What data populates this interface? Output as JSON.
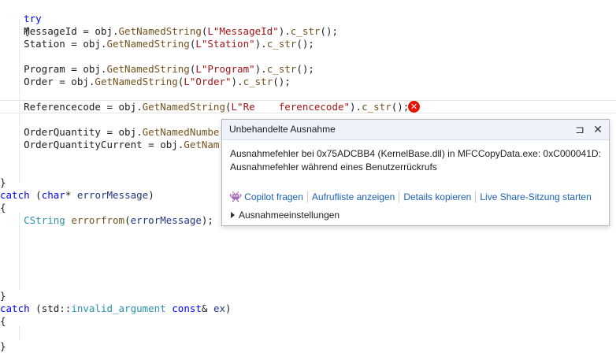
{
  "code": {
    "l_try": "try",
    "l_open1": "{",
    "msg_a": "    MessageId = obj.",
    "msg_fn": "GetNamedString",
    "msg_b": "(",
    "msg_str": "L\"MessageId\"",
    "msg_c": ").",
    "msg_fn2": "c_str",
    "msg_d": "();",
    "st_a": "    Station = obj.",
    "st_fn": "GetNamedString",
    "st_b": "(",
    "st_str": "L\"Station\"",
    "st_c": ").",
    "st_fn2": "c_str",
    "st_d": "();",
    "pr_a": "    Program = obj.",
    "pr_fn": "GetNamedString",
    "pr_b": "(",
    "pr_str": "L\"Program\"",
    "pr_c": ").",
    "pr_fn2": "c_str",
    "pr_d": "();",
    "or_a": "    Order = obj.",
    "or_fn": "GetNamedString",
    "or_b": "(",
    "or_str": "L\"Order\"",
    "or_c": ").",
    "or_fn2": "c_str",
    "or_d": "();",
    "rc_a": "    Referencecode = obj.",
    "rc_fn": "GetNamedString",
    "rc_b": "(",
    "rc_str": "L\"Re    ferencecode\"",
    "rc_c": ").",
    "rc_fn2": "c_str",
    "rc_d": "();",
    "oq_a": "    OrderQuantity = obj.",
    "oq_fn": "GetNamedNumbe",
    "oqc_a": "    OrderQuantityCurrent = obj.",
    "oqc_fn": "GetNam",
    "close1": "}",
    "catch1_kw": "catch",
    "catch1_a": " (",
    "catch1_kw2": "char",
    "catch1_b": "* ",
    "catch1_prm": "errorMessage",
    "catch1_c": ")",
    "open2": "{",
    "cs_type": "    CString",
    "cs_a": " ",
    "cs_fn": "errorfrom",
    "cs_b": "(",
    "cs_prm": "errorMessage",
    "cs_c": ");",
    "close2": "}",
    "catch2_kw": "catch",
    "catch2_a": " (std::",
    "catch2_type": "invalid_argument",
    "catch2_b": " ",
    "catch2_kw2": "const",
    "catch2_c": "& ",
    "catch2_prm": "ex",
    "catch2_d": ")",
    "open3": "{",
    "close3": "}"
  },
  "error_icon": "error-circle-icon",
  "popup": {
    "title": "Unbehandelte Ausnahme",
    "pin_glyph": "⊐",
    "close_glyph": "✕",
    "message_line1": "Ausnahmefehler bei 0x75ADCBB4 (KernelBase.dll) in MFCCopyData.exe: 0xC000041D:",
    "message_line2": "Ausnahmefehler während eines Benutzerrückrufs",
    "copilot_glyph": "👾",
    "actions": [
      "Copilot fragen",
      "Aufrufliste anzeigen",
      "Details kopieren",
      "Live Share-Sitzung starten"
    ],
    "settings_label": "Ausnahmeeinstellungen"
  }
}
